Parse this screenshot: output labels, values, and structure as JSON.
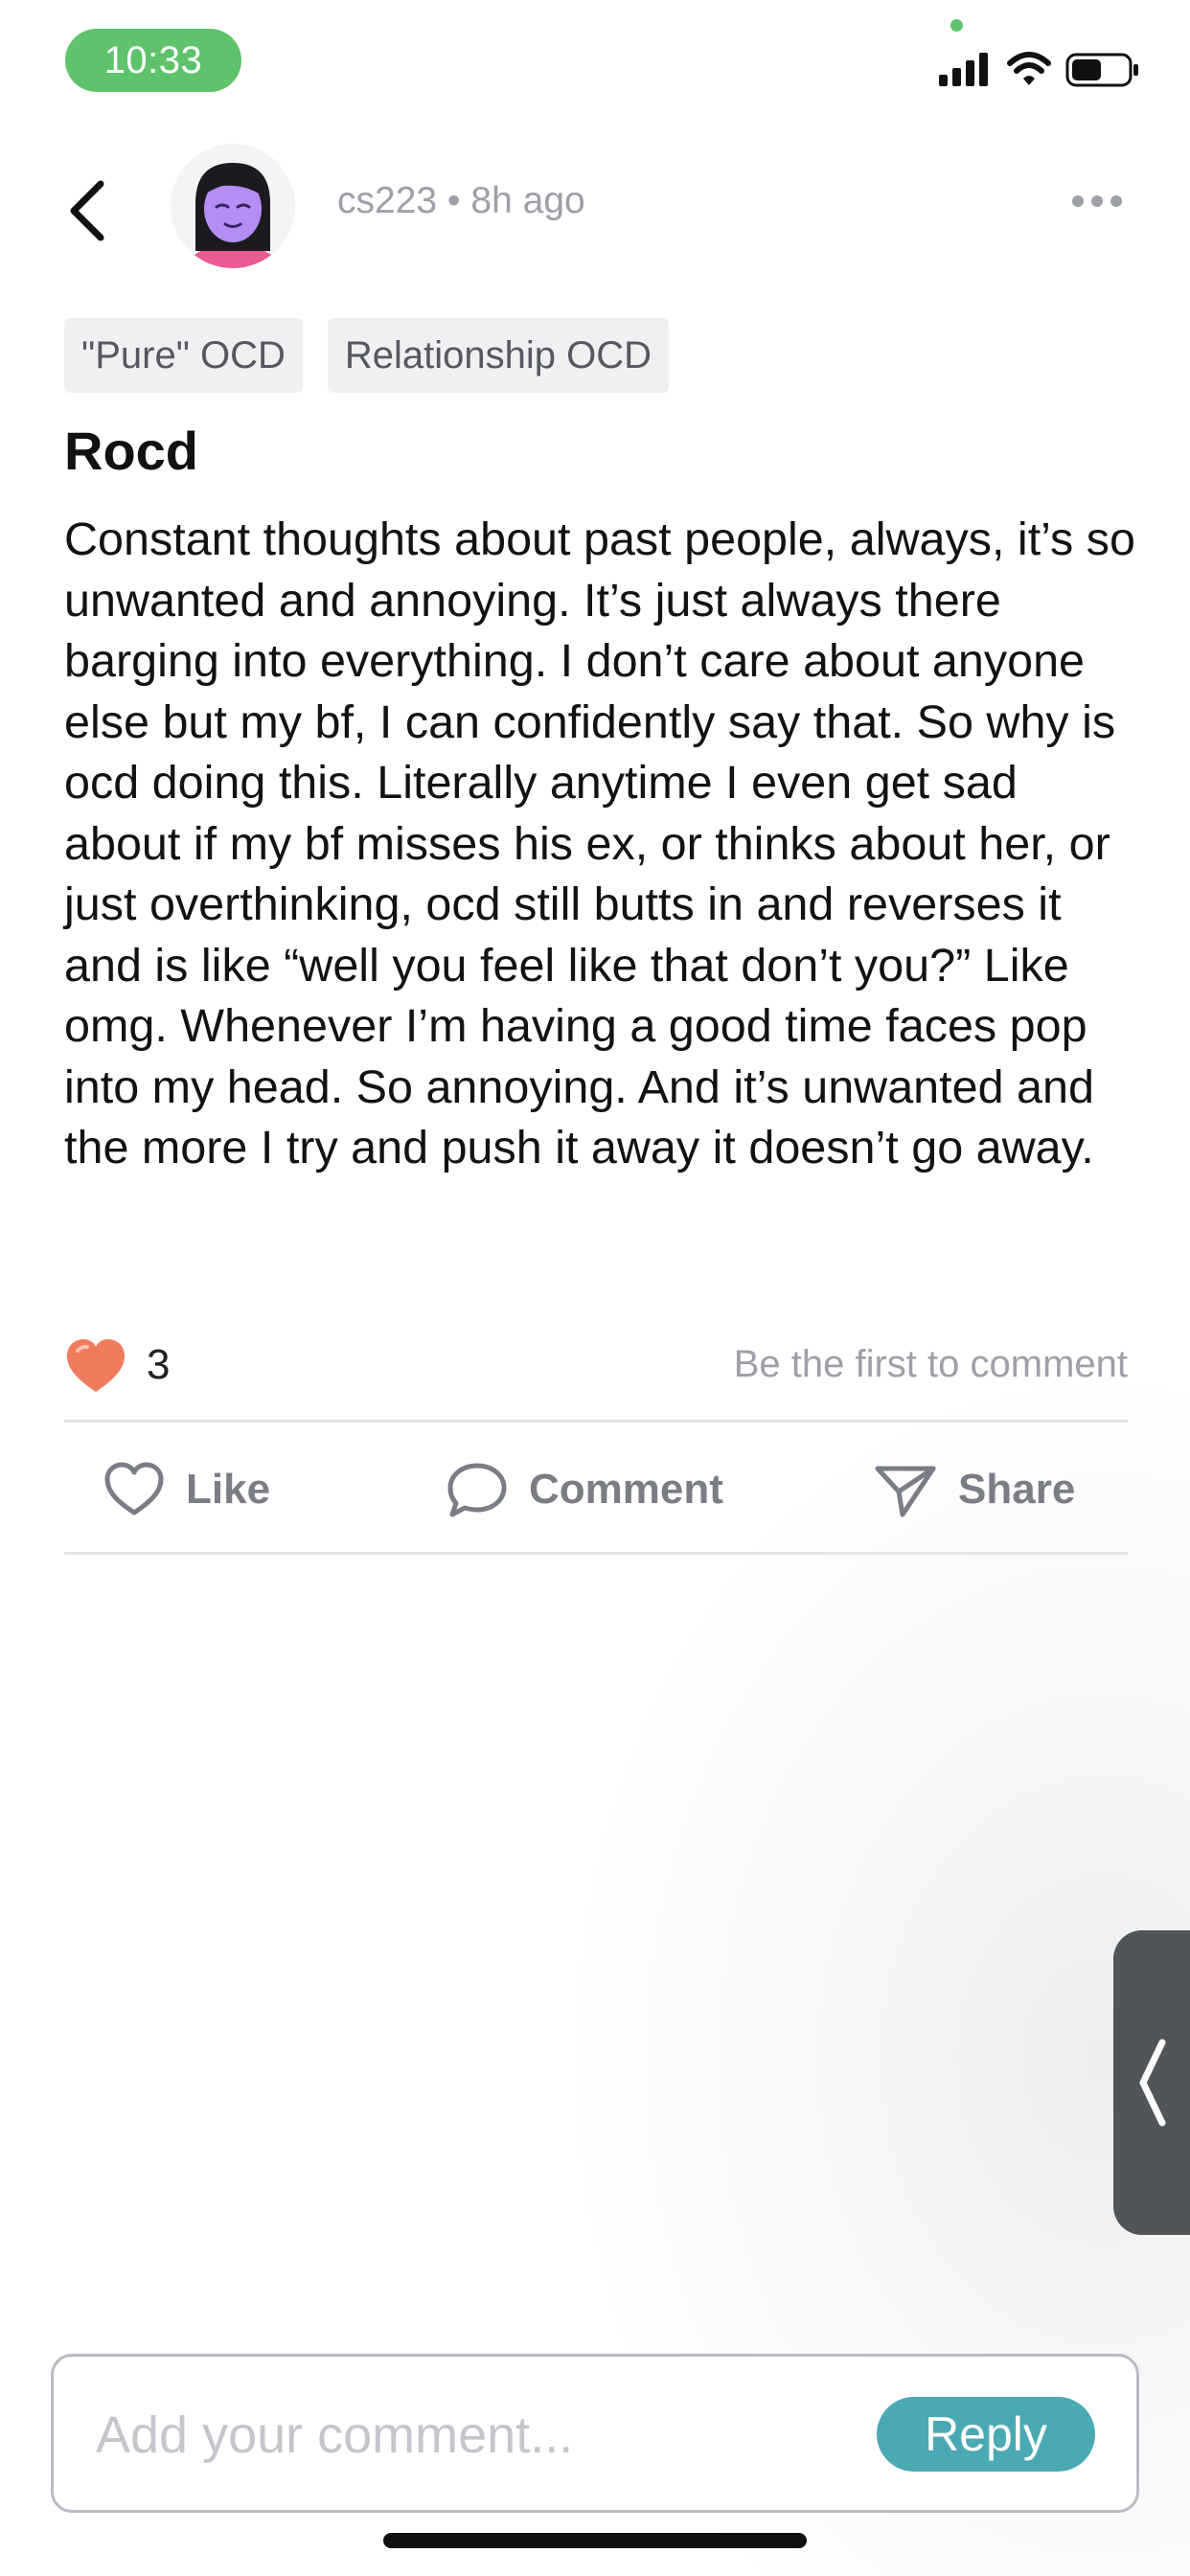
{
  "status_bar": {
    "time": "10:33",
    "icons": [
      "signal-icon",
      "wifi-icon",
      "battery-icon"
    ],
    "accent_color": "#5ec36a"
  },
  "header": {
    "back_icon": "chevron-left-icon",
    "avatar": "avatar",
    "username": "cs223",
    "separator": "•",
    "time_ago": "8h ago",
    "more_icon": "more-horizontal-icon"
  },
  "tags": [
    "\"Pure\" OCD",
    "Relationship OCD"
  ],
  "post": {
    "title": "Rocd",
    "body": "Constant thoughts about past people, always, it’s so unwanted and annoying. It’s just always there barging into everything. I don’t care about anyone else but my bf, I can confidently say that. So why is ocd doing this. Literally anytime I even get sad about if my bf misses his ex, or thinks about her, or just overthinking, ocd still butts in and reverses it and is like “well you feel like that don’t you?” Like omg. Whenever I’m having a good time faces pop into my head. So annoying. And it’s unwanted and the more I try and push it away it doesn’t go away."
  },
  "stats": {
    "likes": "3",
    "comment_prompt": "Be the first to comment",
    "heart_color": "#f07c5c"
  },
  "actions": [
    {
      "label": "Like",
      "icon": "heart-outline-icon"
    },
    {
      "label": "Comment",
      "icon": "speech-bubble-icon"
    },
    {
      "label": "Share",
      "icon": "send-icon"
    }
  ],
  "side_handle": {
    "icon": "chevron-left-icon"
  },
  "composer": {
    "placeholder": "Add your comment...",
    "value": "",
    "reply_label": "Reply",
    "reply_color": "#4aa9b3"
  }
}
